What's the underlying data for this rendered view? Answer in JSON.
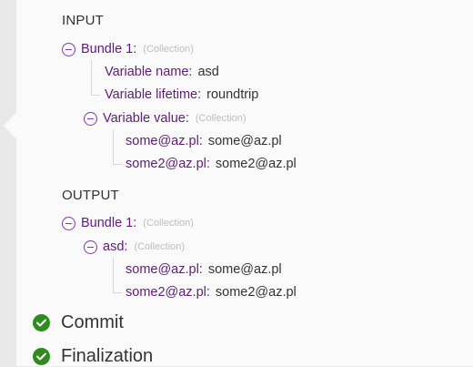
{
  "input": {
    "title": "INPUT",
    "bundle": {
      "label": "Bundle 1:",
      "type_hint": "(Collection)",
      "variable_name": {
        "key": "Variable name:",
        "value": "asd"
      },
      "variable_lifetime": {
        "key": "Variable lifetime:",
        "value": "roundtrip"
      },
      "variable_value": {
        "key": "Variable value:",
        "type_hint": "(Collection)",
        "items": [
          {
            "key": "some@az.pl:",
            "value": "some@az.pl"
          },
          {
            "key": "some2@az.pl:",
            "value": "some2@az.pl"
          }
        ]
      }
    }
  },
  "output": {
    "title": "OUTPUT",
    "bundle": {
      "label": "Bundle 1:",
      "type_hint": "(Collection)",
      "asd": {
        "key": "asd:",
        "type_hint": "(Collection)",
        "items": [
          {
            "key": "some@az.pl:",
            "value": "some@az.pl"
          },
          {
            "key": "some2@az.pl:",
            "value": "some2@az.pl"
          }
        ]
      }
    }
  },
  "steps": [
    {
      "label": "Commit",
      "status": "success",
      "icon": "check-circle-icon"
    },
    {
      "label": "Finalization",
      "status": "success",
      "icon": "check-circle-icon"
    }
  ],
  "colors": {
    "key": "#5e1b7a",
    "toggle": "#7c3bab",
    "success": "#2e8b1e"
  }
}
